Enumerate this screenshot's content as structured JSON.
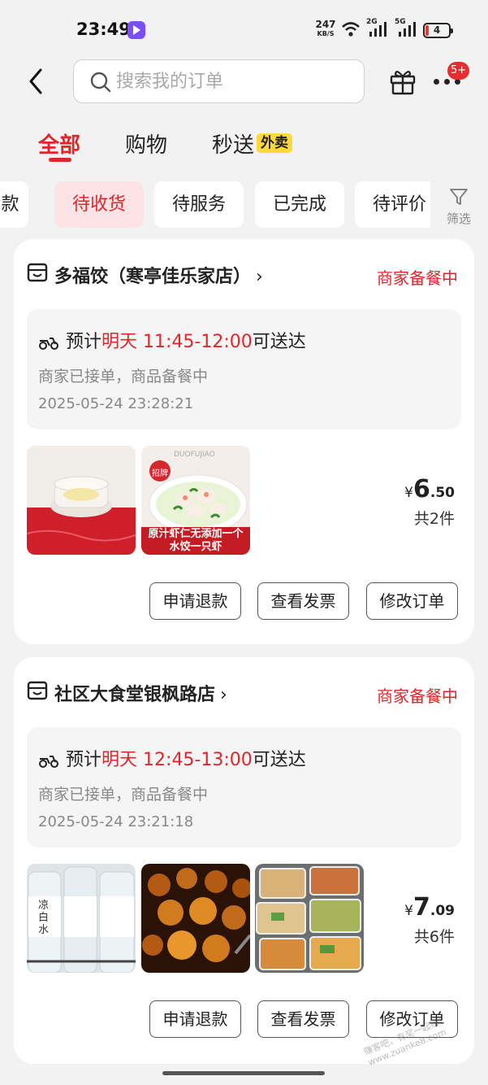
{
  "status_bar": {
    "time": "23:49",
    "net_speed": "247",
    "net_unit": "KB/S",
    "sig1": "2G",
    "sig2": "5G",
    "battery": "4"
  },
  "header": {
    "search_placeholder": "搜索我的订单",
    "badge": "5+"
  },
  "tabs": [
    {
      "label": "全部",
      "active": true
    },
    {
      "label": "购物",
      "active": false
    },
    {
      "label": "秒送",
      "active": false,
      "tag": "外卖"
    }
  ],
  "chips": [
    {
      "label": "款"
    },
    {
      "label": "待收货",
      "active": true
    },
    {
      "label": "待服务"
    },
    {
      "label": "已完成"
    },
    {
      "label": "待评价"
    }
  ],
  "filter_label": "筛选",
  "orders": [
    {
      "shop": "多福饺（寒亭佳乐家店）",
      "status": "商家备餐中",
      "eta_prefix": "预计",
      "eta_day": "明天",
      "eta_time": "11:45-12:00",
      "eta_suffix": "可送达",
      "sub_status": "商家已接单，商品备餐中",
      "time": "2025-05-24 23:28:21",
      "price_symbol": "¥",
      "price_int": "6",
      "price_dec": ".50",
      "count": "共2件",
      "thumb_text": "原汁虾仁无添加一个水饺一只虾",
      "thumb_badge": "招牌",
      "thumb_brand": "DUOFUJIAO",
      "buttons": [
        "申请退款",
        "查看发票",
        "修改订单"
      ]
    },
    {
      "shop": "社区大食堂银枫路店",
      "status": "商家备餐中",
      "eta_prefix": "预计",
      "eta_day": "明天",
      "eta_time": "12:45-13:00",
      "eta_suffix": "可送达",
      "sub_status": "商家已接单，商品备餐中",
      "time": "2025-05-24 23:21:18",
      "price_symbol": "¥",
      "price_int": "7",
      "price_dec": ".09",
      "count": "共6件",
      "thumb_text": "凉白水",
      "buttons": [
        "申请退款",
        "查看发票",
        "修改订单"
      ]
    }
  ],
  "watermark": "赚客吧，有奖一起赚！www.zuanke8.com",
  "colors": {
    "accent": "#e0262b",
    "chip_active_bg": "#fde3e6",
    "tag_yellow": "#ffd83a"
  }
}
